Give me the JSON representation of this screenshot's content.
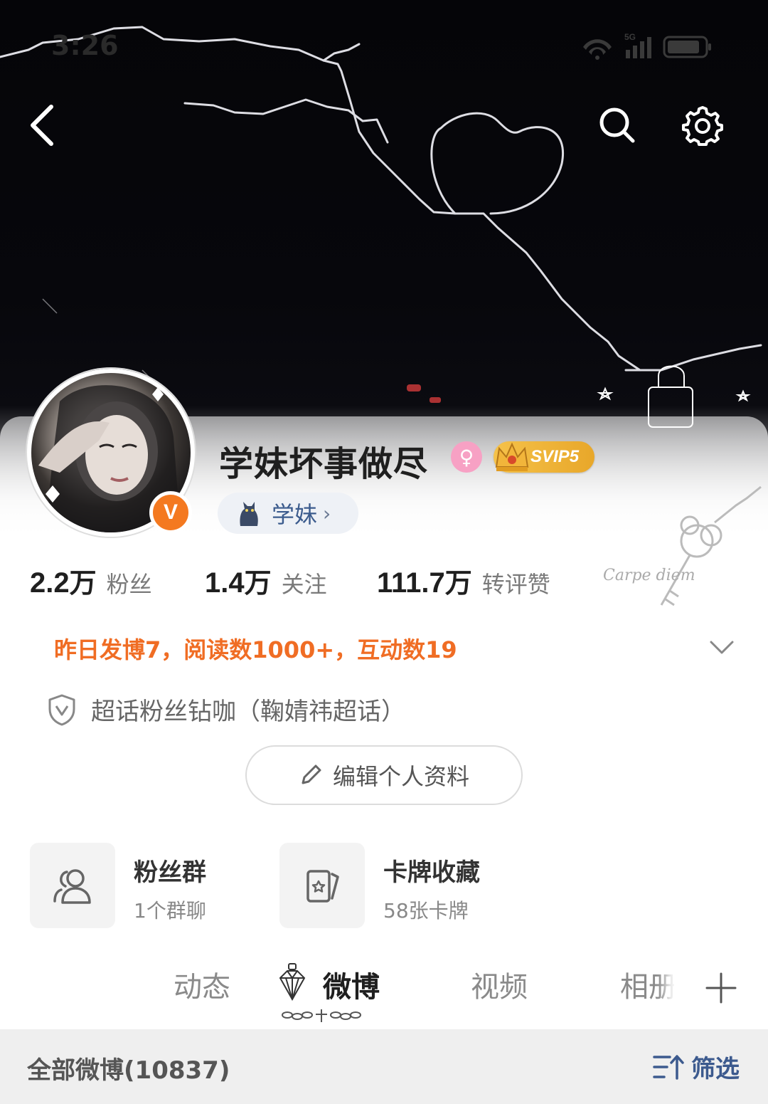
{
  "status_bar": {
    "time": "3:26",
    "network": "5G",
    "icons": [
      "wifi-icon",
      "signal-icon",
      "battery-icon"
    ]
  },
  "header": {
    "back_icon": "chevron-left-icon",
    "search_icon": "search-icon",
    "settings_icon": "gear-icon"
  },
  "profile": {
    "name": "学妹坏事做尽",
    "gender_icon": "female-icon",
    "svip_label": "SVIP5",
    "verified_mark": "V",
    "tag_label": "学妹",
    "tag_arrow": "›",
    "decor_text": "Carpe diem"
  },
  "stats": [
    {
      "value": "2.2",
      "unit": "万",
      "label": "粉丝"
    },
    {
      "value": "1.4",
      "unit": "万",
      "label": "关注"
    },
    {
      "value": "111.7",
      "unit": "万",
      "label": "转评赞"
    }
  ],
  "activity_text": "昨日发博7，阅读数1000+，互动数19",
  "supertopic_text": "超话粉丝钻咖（鞠婧祎超话）",
  "edit_profile_label": "编辑个人资料",
  "features": [
    {
      "title": "粉丝群",
      "sub": "1个群聊",
      "icon": "group-icon"
    },
    {
      "title": "卡牌收藏",
      "sub": "58张卡牌",
      "icon": "card-icon"
    }
  ],
  "tabs": [
    {
      "label": "动态",
      "active": false
    },
    {
      "label": "微博",
      "active": true
    },
    {
      "label": "视频",
      "active": false
    },
    {
      "label": "相册",
      "active": false
    }
  ],
  "filter_bar": {
    "title": "全部微博(10837)",
    "filter_label": "筛选"
  },
  "colors": {
    "accent_orange": "#f06d24",
    "link_blue": "#3c5a8e",
    "verified_orange": "#f47920",
    "svip_gold": "#f5c24a"
  }
}
